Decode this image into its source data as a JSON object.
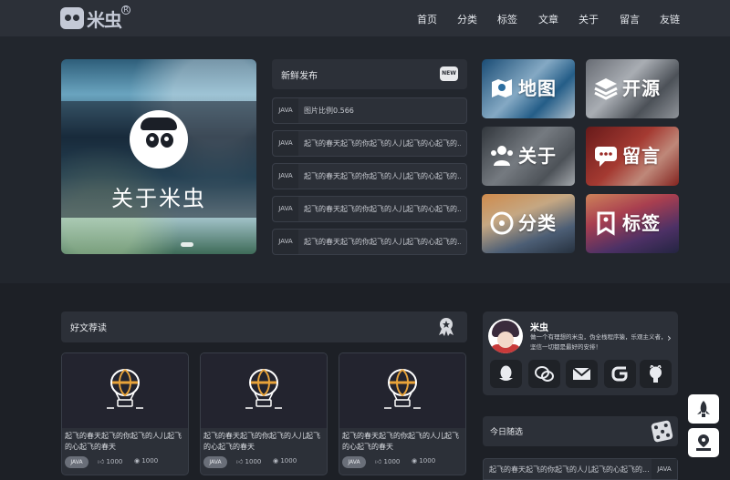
{
  "header": {
    "logo_text": "米虫",
    "logo_registered": "R",
    "nav": [
      "首页",
      "分类",
      "标签",
      "文章",
      "关于",
      "留言",
      "友链"
    ]
  },
  "hero": {
    "title": "关于米虫"
  },
  "news": {
    "title": "新鲜发布",
    "badge": "NEW",
    "items": [
      {
        "tag": "JAVA",
        "text": "图片比例0.566"
      },
      {
        "tag": "JAVA",
        "text": "起飞的春天起飞的你起飞的人儿起飞的心起飞的..."
      },
      {
        "tag": "JAVA",
        "text": "起飞的春天起飞的你起飞的人儿起飞的心起飞的..."
      },
      {
        "tag": "JAVA",
        "text": "起飞的春天起飞的你起飞的人儿起飞的心起飞的..."
      },
      {
        "tag": "JAVA",
        "text": "起飞的春天起飞的你起飞的人儿起飞的心起飞的..."
      }
    ]
  },
  "tiles": [
    {
      "label": "地图",
      "icon": "map-icon"
    },
    {
      "label": "开源",
      "icon": "layers-icon"
    },
    {
      "label": "关于",
      "icon": "users-icon"
    },
    {
      "label": "留言",
      "icon": "chat-icon"
    },
    {
      "label": "分类",
      "icon": "category-icon"
    },
    {
      "label": "标签",
      "icon": "tag-icon"
    }
  ],
  "recommend": {
    "title": "好文荐读",
    "cards": [
      {
        "title": "起飞的春天起飞的你起飞的人儿起飞的心起飞的春天",
        "tag": "JAVA",
        "likes": "1000",
        "views": "1000"
      },
      {
        "title": "起飞的春天起飞的你起飞的人儿起飞的心起飞的春天",
        "tag": "JAVA",
        "likes": "1000",
        "views": "1000"
      },
      {
        "title": "起飞的春天起飞的你起飞的人儿起飞的心起飞的春天",
        "tag": "JAVA",
        "likes": "1000",
        "views": "1000"
      }
    ]
  },
  "profile": {
    "name": "米虫",
    "bio": "做一个有理想的米虫，伪全栈程序猿，乐观主义者，坚信一切都是最好的安排！",
    "arrow": "›",
    "socials": [
      "qq-icon",
      "wechat-icon",
      "mail-icon",
      "gitee-icon",
      "github-icon"
    ]
  },
  "daily": {
    "title": "今日随选",
    "item": {
      "text": "起飞的春天起飞的你起飞的人儿起飞的心起飞的...",
      "tag": "JAVA"
    }
  },
  "colors": {
    "bg": "#22262d",
    "panel": "#2c3038",
    "accent": "#e8a33a"
  }
}
